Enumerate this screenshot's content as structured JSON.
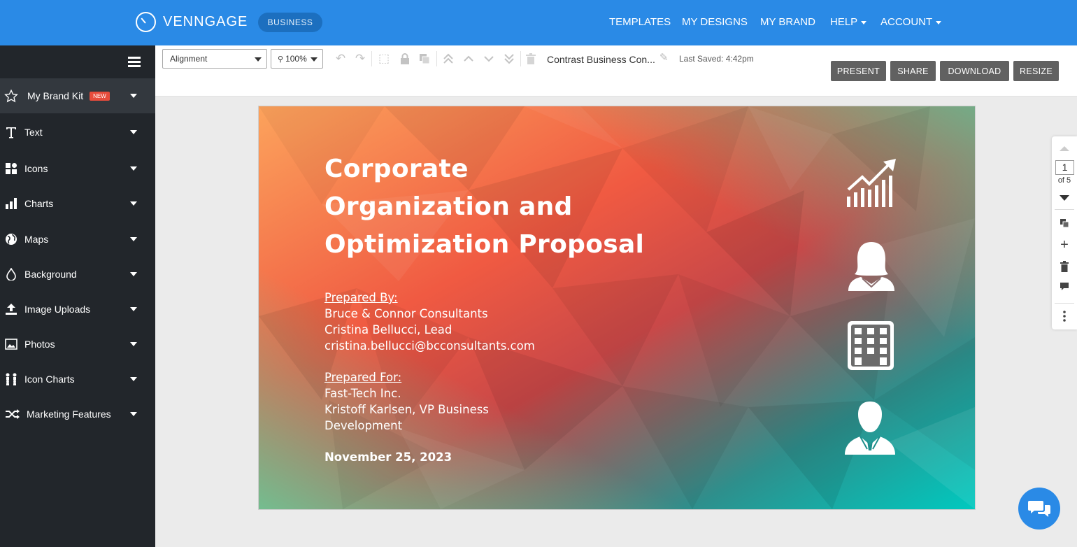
{
  "topbar": {
    "logo_text": "VENNGAGE",
    "plan_badge": "BUSINESS",
    "nav": {
      "templates": "TEMPLATES",
      "my_designs": "MY DESIGNS",
      "my_brand": "MY BRAND",
      "help": "HELP",
      "account": "ACCOUNT"
    }
  },
  "sidebar": {
    "items": [
      {
        "label": "My Brand Kit",
        "badge": "NEW",
        "icon": "star-icon"
      },
      {
        "label": "Text",
        "icon": "text-icon"
      },
      {
        "label": "Icons",
        "icon": "shapes-icon"
      },
      {
        "label": "Charts",
        "icon": "bar-chart-icon"
      },
      {
        "label": "Maps",
        "icon": "globe-icon"
      },
      {
        "label": "Background",
        "icon": "droplet-icon"
      },
      {
        "label": "Image Uploads",
        "icon": "upload-icon"
      },
      {
        "label": "Photos",
        "icon": "image-icon"
      },
      {
        "label": "Icon Charts",
        "icon": "people-chart-icon"
      },
      {
        "label": "Marketing Features",
        "icon": "shuffle-icon"
      }
    ]
  },
  "toolbar": {
    "alignment": "Alignment",
    "zoom": "100%",
    "doc_title": "Contrast Business Con...",
    "last_saved": "Last Saved: 4:42pm",
    "buttons": {
      "present": "PRESENT",
      "share": "SHARE",
      "download": "DOWNLOAD",
      "resize": "RESIZE"
    }
  },
  "slide": {
    "title_lines": [
      "Corporate",
      "Organization and",
      "Optimization Proposal"
    ],
    "prepared_by_label": "Prepared By:",
    "prepared_by_lines": [
      "Bruce & Connor Consultants",
      "Cristina Bellucci, Lead",
      "cristina.bellucci@bcconsultants.com"
    ],
    "prepared_for_label": "Prepared For:",
    "prepared_for_lines": [
      "Fast-Tech Inc.",
      "Kristoff Karlsen, VP Business",
      "Development"
    ],
    "date": "November 25, 2023",
    "icons": [
      "growth-chart-icon",
      "woman-avatar-icon",
      "building-icon",
      "businessman-icon"
    ]
  },
  "pager": {
    "current_page": "1",
    "of_pages": "of 5"
  },
  "colors": {
    "brand_blue": "#2a8ae6",
    "sidebar_bg": "#22262b",
    "button_gray": "#616161"
  }
}
